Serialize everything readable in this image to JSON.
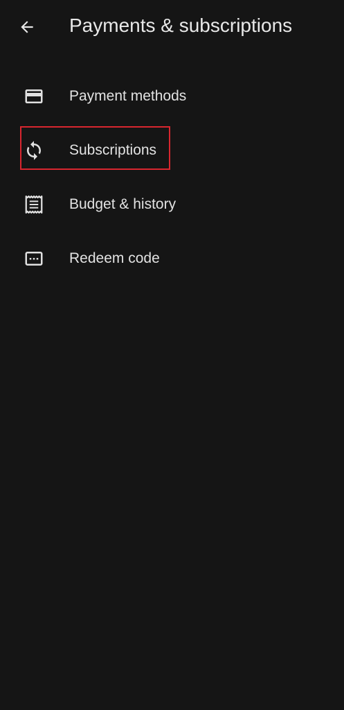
{
  "header": {
    "title": "Payments & subscriptions",
    "back_icon": "arrow-back-icon"
  },
  "menu": {
    "items": [
      {
        "label": "Payment methods",
        "icon": "credit-card-icon"
      },
      {
        "label": "Subscriptions",
        "icon": "refresh-icon",
        "highlighted": true
      },
      {
        "label": "Budget & history",
        "icon": "receipt-icon"
      },
      {
        "label": "Redeem code",
        "icon": "redeem-code-icon"
      }
    ]
  },
  "colors": {
    "background": "#151515",
    "text": "#e2e2e2",
    "highlight_border": "#d9262f"
  }
}
